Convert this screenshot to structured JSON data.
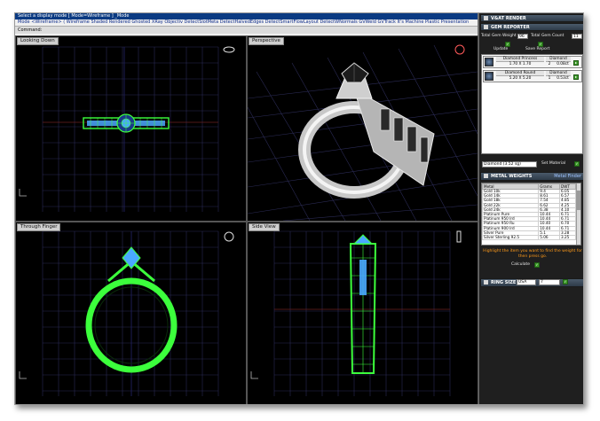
{
  "command": {
    "selected_line": "Select a display mode [ Mode=Wireframe ] _Mode",
    "options_line": "Mode <Wireframe> ( Wireframe  Shaded  Rendered  Ghosted  XRay  Objectiv  DetectSlotMeta  DetectHalvedEdges  DetectSmartFlowLayout  DetectWNormals  GVWeld  GVTrack  It's  Machine  Plastic  Presentation",
    "prompt": "Command:"
  },
  "viewports": {
    "top_left": {
      "title": "Looking Down"
    },
    "top_right": {
      "title": "Perspective"
    },
    "bottom_left": {
      "title": "Through Finger"
    },
    "bottom_right": {
      "title": "Side View"
    }
  },
  "panel": {
    "vray_header": "V&AT RENDER",
    "gem_header": "GEM REPORTER",
    "total_gem_weight_label": "Total Gem Weight",
    "total_gem_weight_value": "96",
    "total_gem_count_label": "Total Gem Count",
    "total_gem_count_value": "11",
    "update_label": "Update",
    "save_report_label": "Save Report",
    "gems": [
      {
        "name": "Diamond Princess",
        "type": "Diamond",
        "size": "1.70 X 1.70",
        "count": "2",
        "weight": "0.08ct"
      },
      {
        "name": "Diamond Round",
        "type": "Diamond",
        "size": "5.20 X 5.20",
        "count": "1",
        "weight": "0.53ct"
      }
    ],
    "material_select": "Diamond     (3.52 sg)",
    "set_material_label": "Set Material",
    "metal_header": "METAL WEIGHTS",
    "metal_header_right": "Metal Finder",
    "metal_columns": [
      "Metal",
      "Grams",
      "DWT"
    ],
    "metals": [
      [
        "Gold 10k",
        "9.4",
        "6.05"
      ],
      [
        "Gold 14k",
        "8.61",
        "6.57"
      ],
      [
        "Gold 18k",
        "7.54",
        "4.85"
      ],
      [
        "Gold 22k",
        "6.62",
        "4.25"
      ],
      [
        "Gold 24k",
        "6.38",
        "4.10"
      ],
      [
        "Platinum Pure",
        "10.44",
        "6.71"
      ],
      [
        "Platinum 950 Ird",
        "10.44",
        "6.71"
      ],
      [
        "Platinum 950 Ru",
        "10.40",
        "6.70"
      ],
      [
        "Platinum 900 Ird",
        "10.44",
        "6.71"
      ],
      [
        "Silver Pure",
        "5.1",
        "3.28"
      ],
      [
        "Silver Sterling 92.5",
        "5.06",
        "3.25"
      ]
    ],
    "highlight_note": "Highlight the item you want to find the weight for then press go.",
    "calculate_label": "Calculate",
    "ring_header": "RING SIZE",
    "ring_standard": "USA",
    "ring_size": "7"
  },
  "colors": {
    "wire": "#3cff3c",
    "grid": "#2b2b55",
    "stone": "#4aa8ff",
    "accent_orange": "#ff9a1a"
  }
}
